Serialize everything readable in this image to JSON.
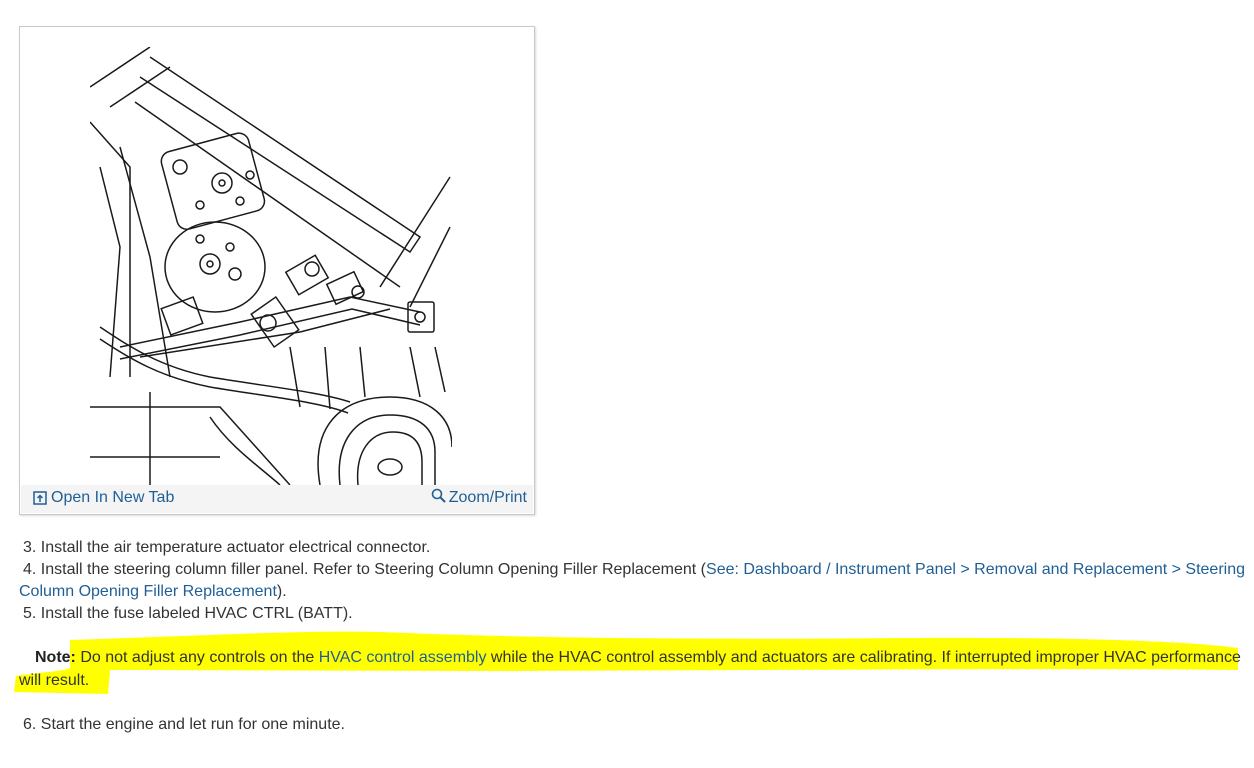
{
  "figure": {
    "open_new_tab": "Open In New Tab",
    "zoom_print": "Zoom/Print"
  },
  "steps": [
    {
      "num": "3.",
      "text": "Install the air temperature actuator electrical connector."
    },
    {
      "num": "4.",
      "text": "Install the steering column filler panel. Refer to Steering Column Opening Filler Replacement (",
      "link_line1": "See: Dashboard / Instrument Panel > Removal and Replacement > Steering",
      "link_line2": "Column Opening Filler Replacement",
      "tail": ")."
    },
    {
      "num": "5.",
      "text": "Install the fuse labeled HVAC CTRL (BATT)."
    },
    {
      "num": "6.",
      "text": "Start the engine and let run for one minute."
    }
  ],
  "note": {
    "label": "Note:",
    "part1": "Do not adjust any controls on the ",
    "link": "HVAC control assembly",
    "part2": " while the HVAC control assembly and actuators are calibrating. If interrupted improper HVAC performance",
    "line2": "will result."
  },
  "colors": {
    "link": "#1f5f96",
    "highlight": "#ffff00"
  }
}
